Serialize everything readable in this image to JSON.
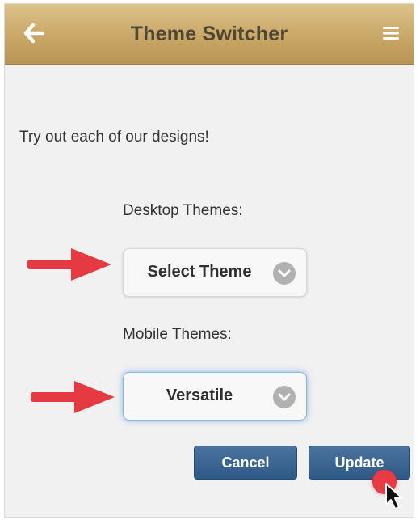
{
  "header": {
    "title": "Theme Switcher",
    "back_icon": "back-arrow-icon",
    "menu_icon": "menu-icon"
  },
  "content": {
    "intro": "Try out each of our designs!",
    "desktop_label": "Desktop Themes:",
    "desktop_selected": "Select Theme",
    "mobile_label": "Mobile Themes:",
    "mobile_selected": "Versatile"
  },
  "actions": {
    "cancel_label": "Cancel",
    "update_label": "Update"
  },
  "colors": {
    "header_top": "#dcc28c",
    "header_bottom": "#b89455",
    "title_text": "#4f4633",
    "button_blue": "#2f5986",
    "annotation_red": "#e63a43"
  }
}
